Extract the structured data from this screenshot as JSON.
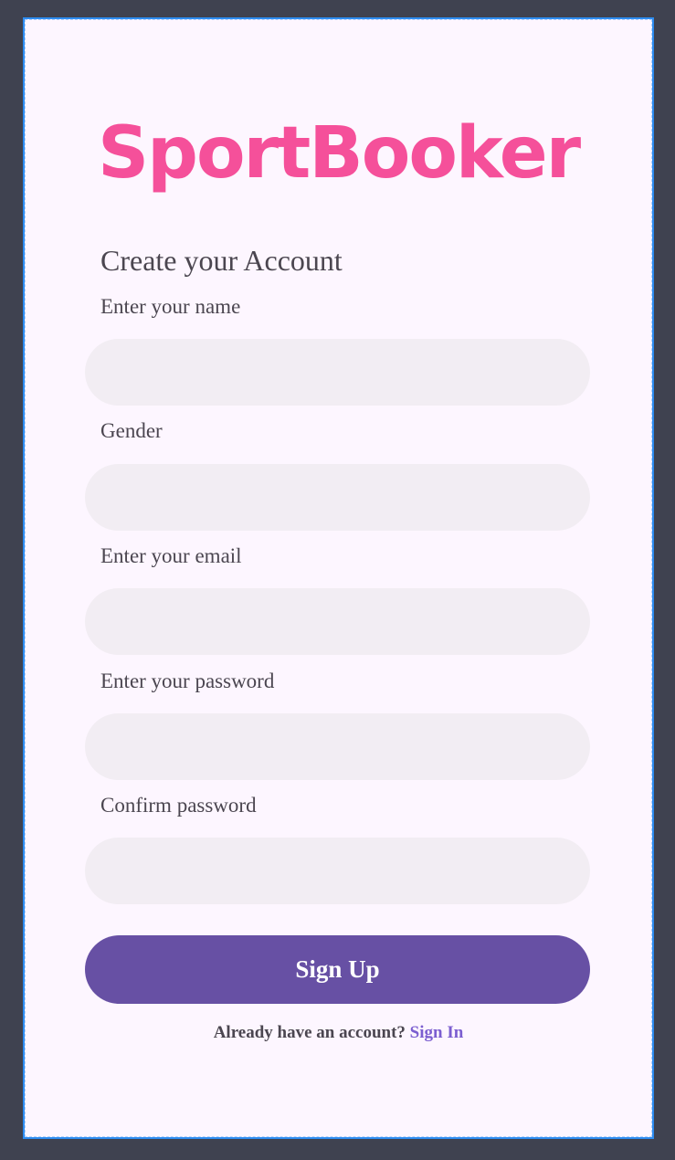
{
  "app": {
    "logo": "SportBooker"
  },
  "form": {
    "heading": "Create your Account",
    "fields": [
      {
        "label": "Enter your name",
        "value": "",
        "placeholder": ""
      },
      {
        "label": "Gender",
        "value": "",
        "placeholder": ""
      },
      {
        "label": "Enter your email",
        "value": "",
        "placeholder": ""
      },
      {
        "label": "Enter your password",
        "value": "",
        "placeholder": ""
      },
      {
        "label": "Confirm password",
        "value": "",
        "placeholder": ""
      }
    ],
    "submit_label": "Sign Up"
  },
  "footer": {
    "prompt": "Already have an account?",
    "link_label": "Sign In"
  },
  "colors": {
    "background": "#3f4250",
    "card": "#fdf6ff",
    "logo": "#f5509a",
    "input_fill": "#f2edf3",
    "primary_button": "#6750a4",
    "link": "#7b5ed0",
    "text": "#4b4650",
    "frame_border": "#2d8cf0"
  }
}
